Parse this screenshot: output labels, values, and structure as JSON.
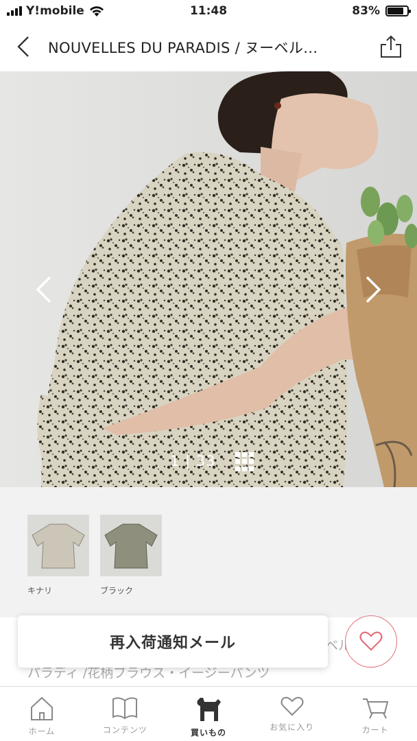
{
  "status_bar": {
    "carrier": "Y!mobile",
    "time": "11:48",
    "battery": "83%",
    "battery_level": 0.83
  },
  "header": {
    "title": "NOUVELLES DU PARADIS / ヌーベル…",
    "back_icon": "chevron-left-icon",
    "share_icon": "share-icon"
  },
  "gallery": {
    "current": "1",
    "total": "33",
    "counter": "1 | 33",
    "prev_icon": "chevron-left-icon",
    "next_icon": "chevron-right-icon",
    "grid_icon": "grid-icon"
  },
  "swatches": [
    {
      "label": "キナリ",
      "color": "#cbc6b8"
    },
    {
      "label": "ブラック",
      "color": "#8f8f7e"
    }
  ],
  "product": {
    "brand_tail": "ベル",
    "name_peek": "パラディ /花柄ブラウス・イージーパンツ"
  },
  "restock_button": {
    "label": "再入荷通知メール"
  },
  "favorite_button": {
    "icon": "heart-icon",
    "color": "#e0707a"
  },
  "tabs": [
    {
      "label": "ホーム",
      "icon": "home-icon",
      "active": false
    },
    {
      "label": "コンテンツ",
      "icon": "book-icon",
      "active": false
    },
    {
      "label": "買いもの",
      "icon": "horse-icon",
      "active": true
    },
    {
      "label": "お気に入り",
      "icon": "heart-icon",
      "active": false
    },
    {
      "label": "カート",
      "icon": "cart-icon",
      "active": false
    }
  ]
}
